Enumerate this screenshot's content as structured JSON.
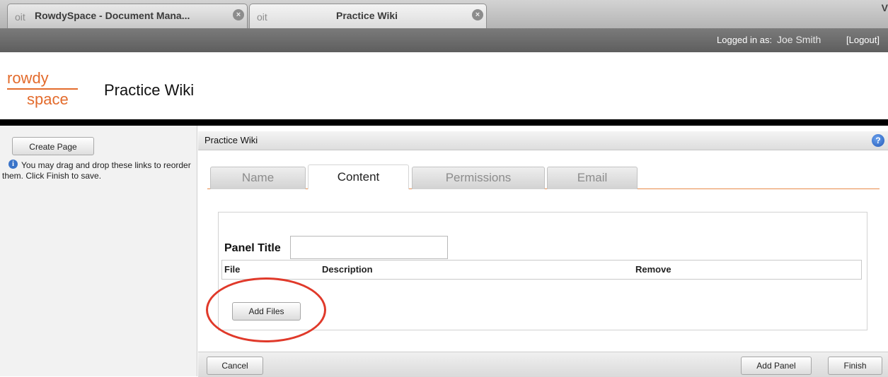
{
  "browser": {
    "tabs": [
      {
        "favicon": "oit",
        "title": "RowdySpace - Document Mana...",
        "close": "×"
      },
      {
        "favicon": "oit",
        "title": "Practice Wiki",
        "close": "×"
      }
    ],
    "edge_glyph": "V"
  },
  "userbar": {
    "logged_label": "Logged in as:",
    "user_name": "Joe Smith",
    "logout": "[Logout]"
  },
  "header": {
    "logo_top": "rowdy",
    "logo_bottom": "space",
    "site_title": "Practice Wiki",
    "accent": "#e36b2c"
  },
  "sidebar": {
    "create_page_label": "Create Page",
    "info_icon": "i",
    "hint": "You may drag and drop these links to reorder them. Click Finish to save."
  },
  "main": {
    "breadcrumb": "Practice Wiki",
    "help_icon": "?",
    "tabs": [
      {
        "label": "Name",
        "active": false
      },
      {
        "label": "Content",
        "active": true
      },
      {
        "label": "Permissions",
        "active": false
      },
      {
        "label": "Email",
        "active": false
      }
    ],
    "panel_title_label": "Panel Title",
    "panel_title_value": "",
    "columns": [
      "File",
      "Description",
      "Remove"
    ],
    "add_files_label": "Add Files"
  },
  "footer": {
    "cancel_label": "Cancel",
    "add_panel_label": "Add Panel",
    "finish_label": "Finish"
  },
  "colors": {
    "highlight_circle": "#e0392a",
    "tab_underline": "#e98a4a"
  }
}
